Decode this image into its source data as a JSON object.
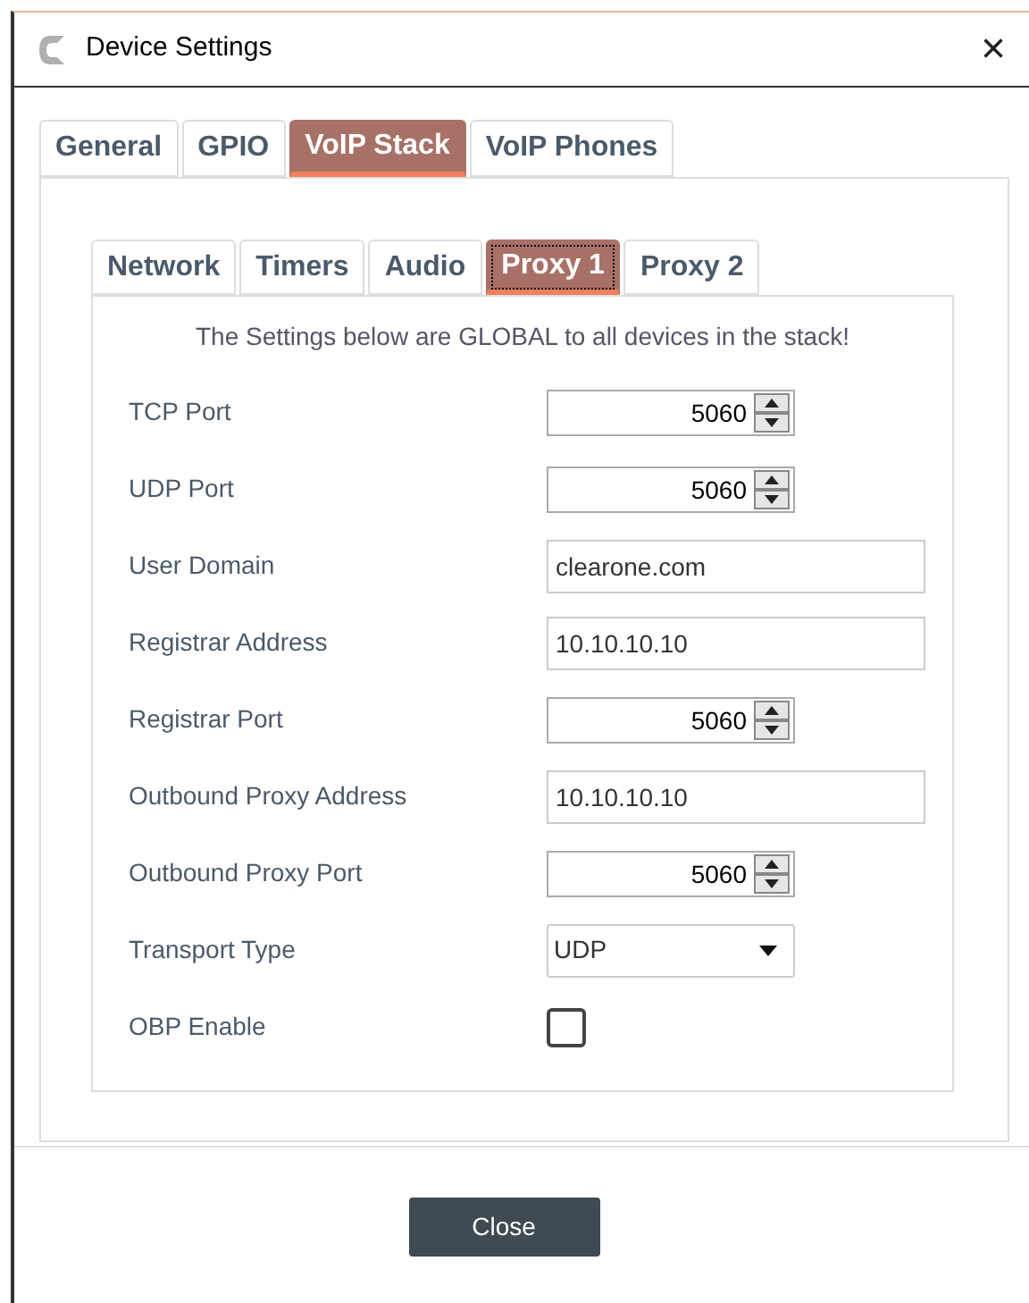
{
  "window": {
    "title": "Device Settings",
    "close": "×"
  },
  "tabs": [
    {
      "label": "General",
      "selected": false
    },
    {
      "label": "GPIO",
      "selected": false
    },
    {
      "label": "VoIP Stack",
      "selected": true
    },
    {
      "label": "VoIP Phones",
      "selected": false
    }
  ],
  "subtabs": [
    {
      "label": "Network",
      "selected": false
    },
    {
      "label": "Timers",
      "selected": false
    },
    {
      "label": "Audio",
      "selected": false
    },
    {
      "label": "Proxy 1",
      "selected": true
    },
    {
      "label": "Proxy 2",
      "selected": false
    }
  ],
  "notice": "The Settings below are GLOBAL to all devices in the stack!",
  "fields": [
    {
      "kind": "spin",
      "label": "TCP Port",
      "value": "5060"
    },
    {
      "kind": "spin",
      "label": "UDP Port",
      "value": "5060"
    },
    {
      "kind": "text",
      "label": "User Domain",
      "value": "clearone.com"
    },
    {
      "kind": "text",
      "label": "Registrar Address",
      "value": "10.10.10.10"
    },
    {
      "kind": "spin",
      "label": "Registrar Port",
      "value": "5060"
    },
    {
      "kind": "text",
      "label": "Outbound Proxy Address",
      "value": "10.10.10.10"
    },
    {
      "kind": "spin",
      "label": "Outbound Proxy Port",
      "value": "5060"
    },
    {
      "kind": "dropdown",
      "label": "Transport Type",
      "value": "UDP"
    },
    {
      "kind": "checkbox",
      "label": "OBP Enable",
      "checked": false
    }
  ],
  "buttons": [
    "Close"
  ]
}
